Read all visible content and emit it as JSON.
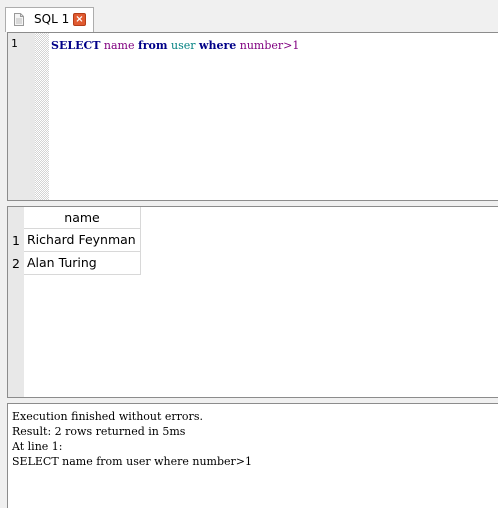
{
  "tab": {
    "label": "SQL 1",
    "icon": "document-icon",
    "close_icon": "close-icon",
    "close_glyph": "×",
    "close_color": "#e05a30"
  },
  "editor": {
    "line_number": "1",
    "tokens": {
      "select": "SELECT",
      "column": "name",
      "from": "from",
      "table": "user",
      "where": "where",
      "condition": "number>1"
    },
    "colors": {
      "keyword": "#000088",
      "identifier": "#800080",
      "table": "#008080"
    }
  },
  "results": {
    "columns": [
      "name"
    ],
    "rows": [
      {
        "num": "1",
        "name": "Richard Feynman"
      },
      {
        "num": "2",
        "name": "Alan Turing"
      }
    ]
  },
  "messages": {
    "lines": [
      "Execution finished without errors.",
      "Result: 2 rows returned in 5ms",
      "At line 1:",
      "SELECT name from user where number>1"
    ]
  }
}
